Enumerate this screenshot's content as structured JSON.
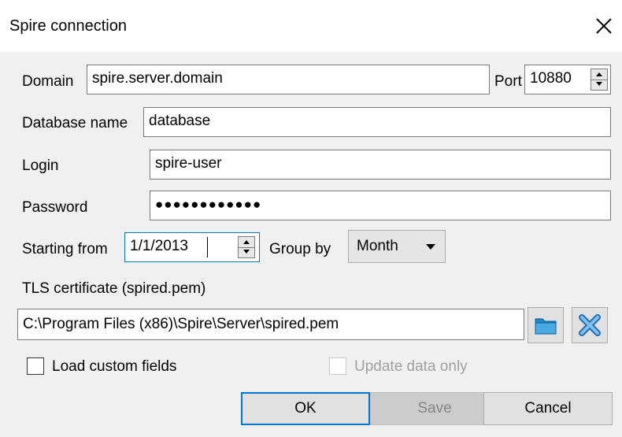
{
  "window": {
    "title": "Spire connection",
    "close_icon": "close-icon"
  },
  "form": {
    "domain_label": "Domain",
    "domain_value": "spire.server.domain",
    "port_label": "Port",
    "port_value": "10880",
    "database_label": "Database name",
    "database_value": "database",
    "login_label": "Login",
    "login_value": "spire-user",
    "password_label": "Password",
    "password_masked": "●●●●●●●●●●●●",
    "starting_label": "Starting from",
    "starting_value": "1/1/2013",
    "groupby_label": "Group by",
    "groupby_value": "Month",
    "tls_label": "TLS certificate (spired.pem)",
    "tls_path": "C:\\Program Files (x86)\\Spire\\Server\\spired.pem",
    "browse_icon": "folder-icon",
    "clear_icon": "clear-x-icon",
    "load_custom_label": "Load custom fields",
    "load_custom_checked": false,
    "update_only_label": "Update data only",
    "update_only_checked": false,
    "update_only_enabled": false
  },
  "buttons": {
    "ok": "OK",
    "save": "Save",
    "cancel": "Cancel"
  },
  "colors": {
    "accent": "#0078d7",
    "folder": "#1e88c8",
    "clear": "#3a8fd6"
  }
}
